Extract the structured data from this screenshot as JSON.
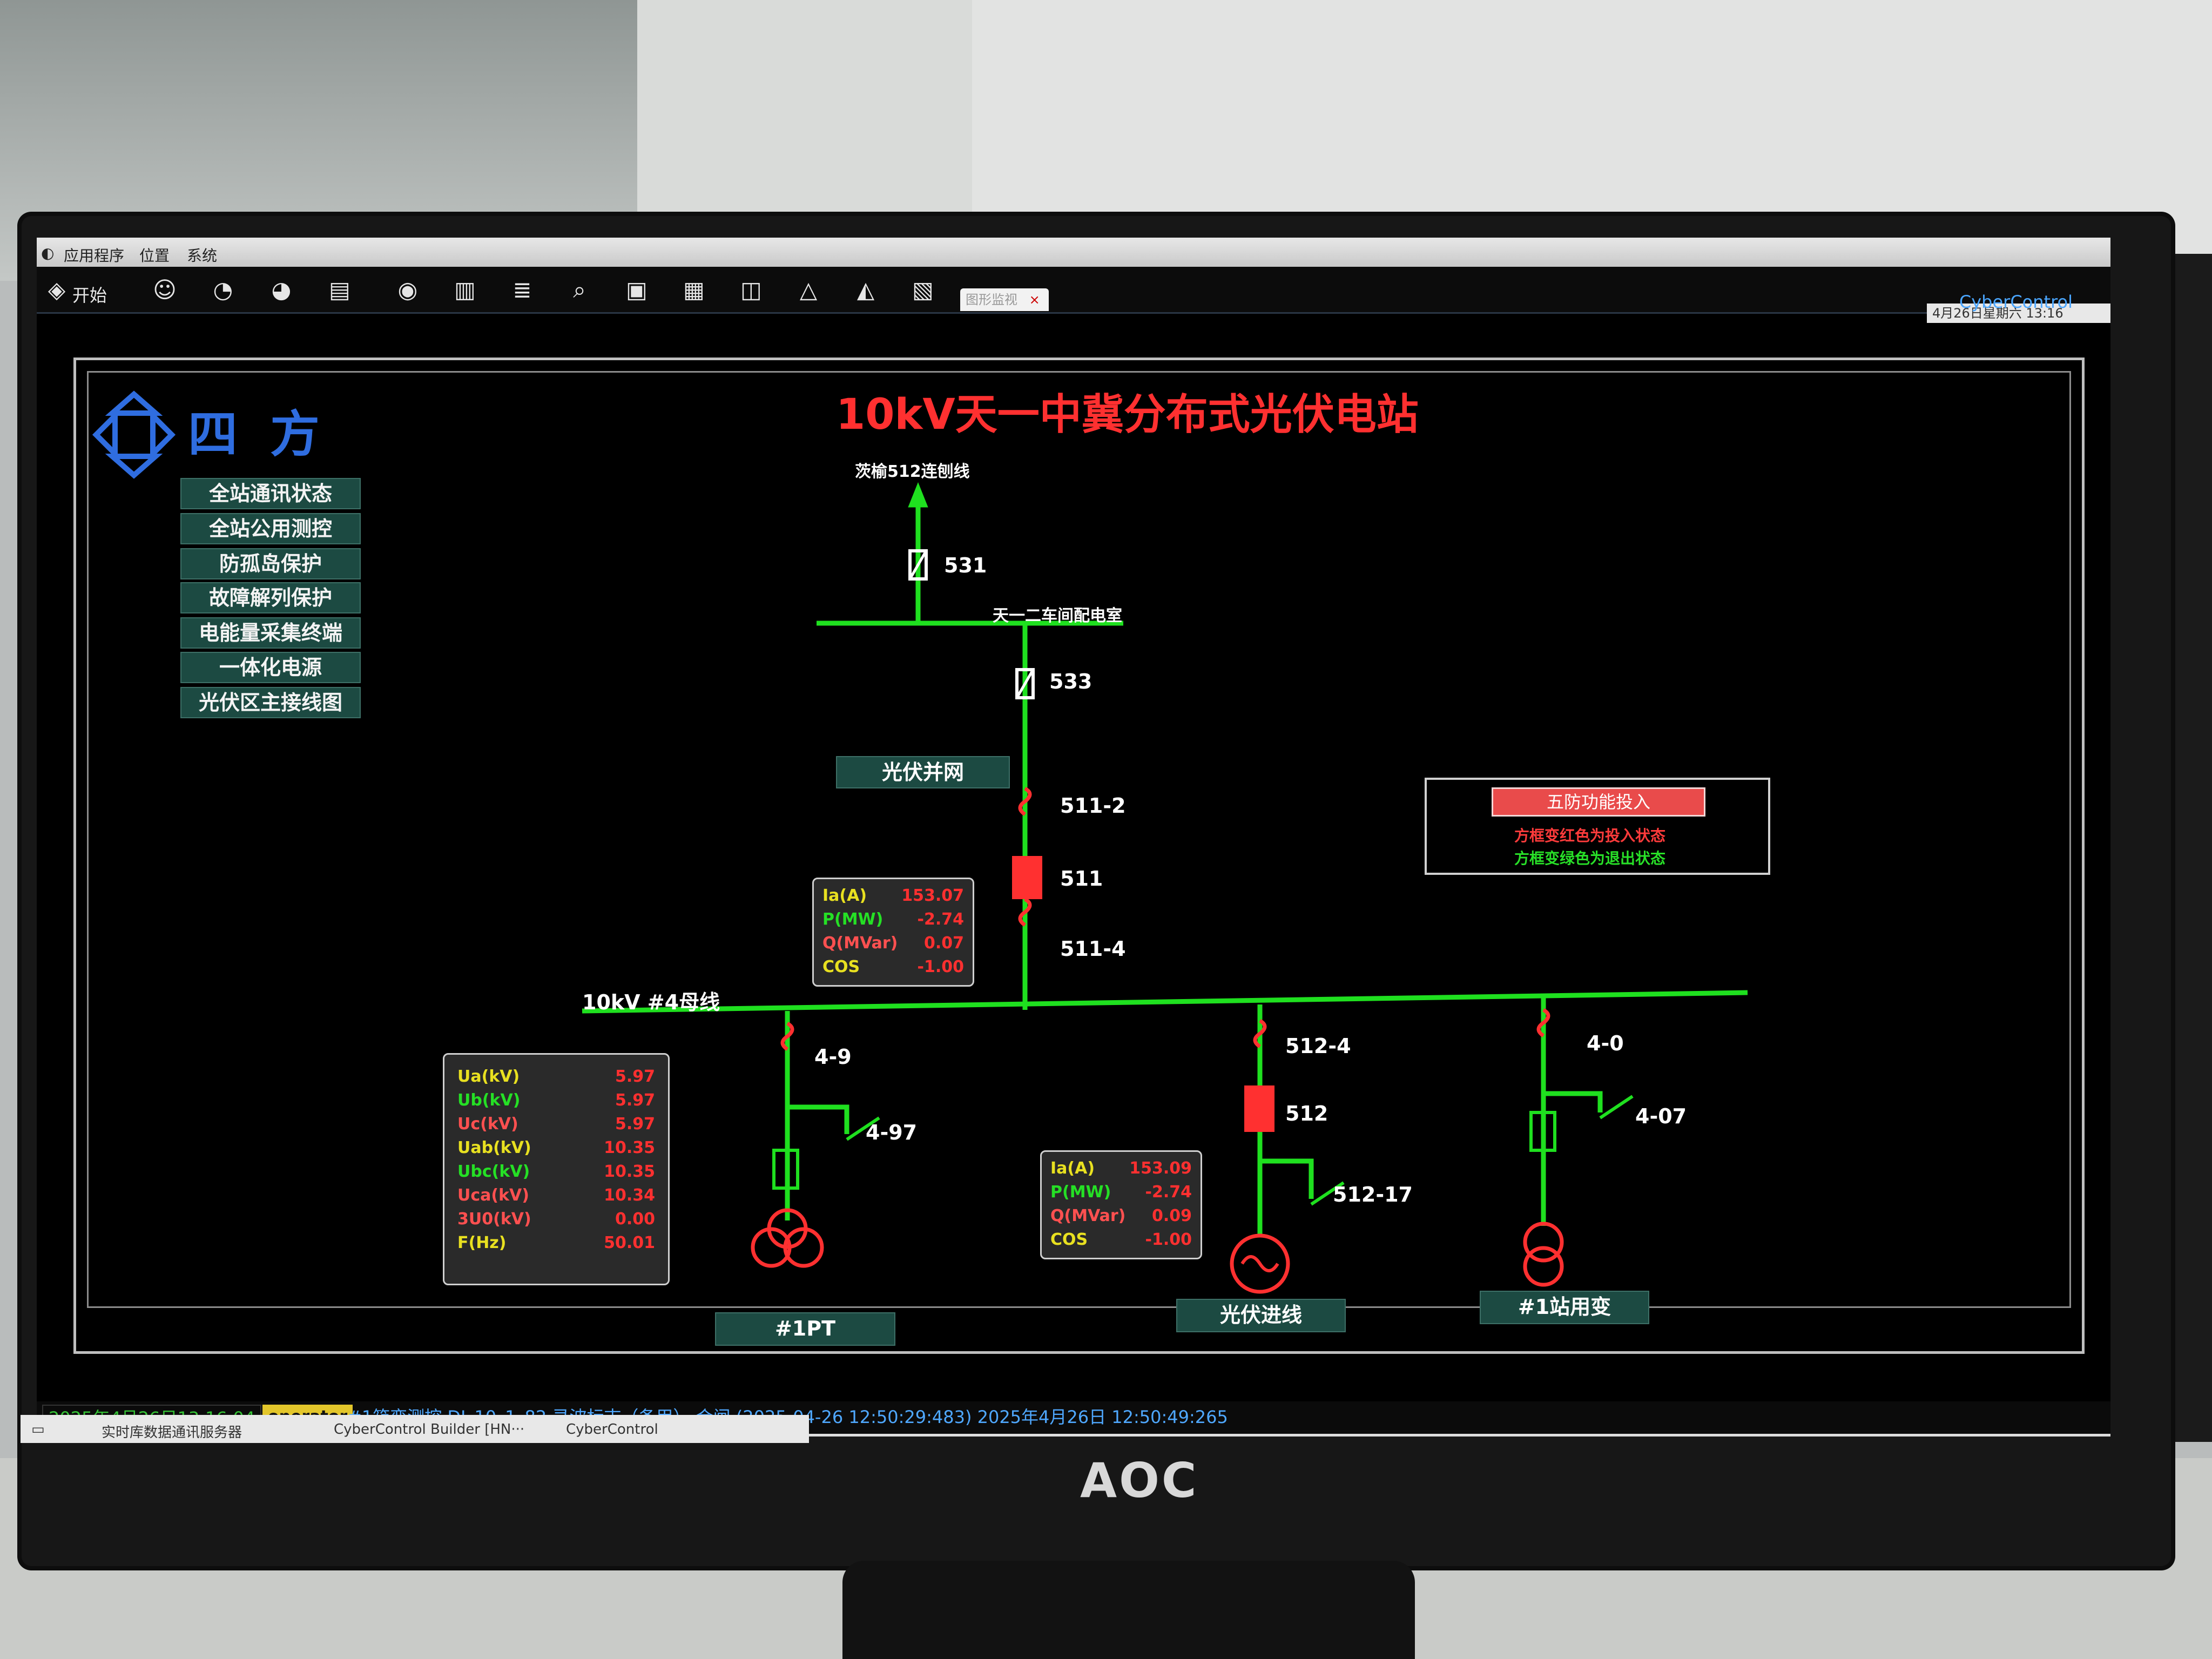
{
  "menubar": {
    "items": [
      "应用程序",
      "位置",
      "系统"
    ]
  },
  "toolbar": {
    "start_label": "开始",
    "active_tab": "图形监视",
    "tab_close": "×",
    "brand": "CyberControl",
    "tray_time": "4月26日星期六 13:16"
  },
  "logo": {
    "text": "四 方"
  },
  "title": "10kV天一中冀分布式光伏电站",
  "nav": [
    "全站通讯状态",
    "全站公用测控",
    "防孤岛保护",
    "故障解列保护",
    "电能量采集终端",
    "一体化电源",
    "光伏区主接线图"
  ],
  "diagram": {
    "top_line": "茨榆512连刨线",
    "switch_531": "531",
    "bus_upper": "天一二车间配电室",
    "switch_533": "533",
    "pv_grid_btn": "光伏并网",
    "sw_511_2": "511-2",
    "brk_511": "511",
    "sw_511_4": "511-4",
    "bus_label": "10kV #4母线",
    "sw_4_9": "4-9",
    "sw_4_97": "4-97",
    "sw_512_4": "512-4",
    "brk_512": "512",
    "sw_512_17": "512-17",
    "sw_4_0": "4-0",
    "sw_4_07": "4-07",
    "pt_btn": "#1PT",
    "pv_in_btn": "光伏进线",
    "station_tx_btn": "#1站用变"
  },
  "panel_511": [
    {
      "name": "Ia(A)",
      "value": "153.07",
      "color": "y"
    },
    {
      "name": "P(MW)",
      "value": "-2.74",
      "color": "g"
    },
    {
      "name": "Q(MVar)",
      "value": "0.07",
      "color": "r"
    },
    {
      "name": "COS",
      "value": "-1.00",
      "color": "y"
    }
  ],
  "panel_512": [
    {
      "name": "Ia(A)",
      "value": "153.09",
      "color": "y"
    },
    {
      "name": "P(MW)",
      "value": "-2.74",
      "color": "g"
    },
    {
      "name": "Q(MVar)",
      "value": "0.09",
      "color": "r"
    },
    {
      "name": "COS",
      "value": "-1.00",
      "color": "y"
    }
  ],
  "panel_pt": [
    {
      "name": "Ua(kV)",
      "value": "5.97",
      "color": "y"
    },
    {
      "name": "Ub(kV)",
      "value": "5.97",
      "color": "g"
    },
    {
      "name": "Uc(kV)",
      "value": "5.97",
      "color": "r"
    },
    {
      "name": "Uab(kV)",
      "value": "10.35",
      "color": "y"
    },
    {
      "name": "Ubc(kV)",
      "value": "10.35",
      "color": "g"
    },
    {
      "name": "Uca(kV)",
      "value": "10.34",
      "color": "r"
    },
    {
      "name": "3U0(kV)",
      "value": "0.00",
      "color": "r"
    },
    {
      "name": "F(Hz)",
      "value": "50.01",
      "color": "y"
    }
  ],
  "five_protection": {
    "button": "五防功能投入",
    "red_note": "方框变红色为投入状态",
    "green_note": "方框变绿色为退出状态"
  },
  "status": {
    "datetime": "2025年4月26日13:16:04",
    "operator": "operator",
    "message": "#1箱变测控  DI_10_1_82  录波标志（备用）  合闸 (2025-04-26 12:50:29:483)  2025年4月26日 12:50:49:265"
  },
  "taskbar": {
    "items": [
      "实时库数据通讯服务器",
      "CyberControl Builder [HN···",
      "CyberControl"
    ]
  },
  "monitor_brand": "AOC",
  "colors": {
    "bus_green": "#1fe01f",
    "breaker_red": "#ff3030",
    "title_red": "#ff3030",
    "nav_bg": "#1c4a42"
  }
}
